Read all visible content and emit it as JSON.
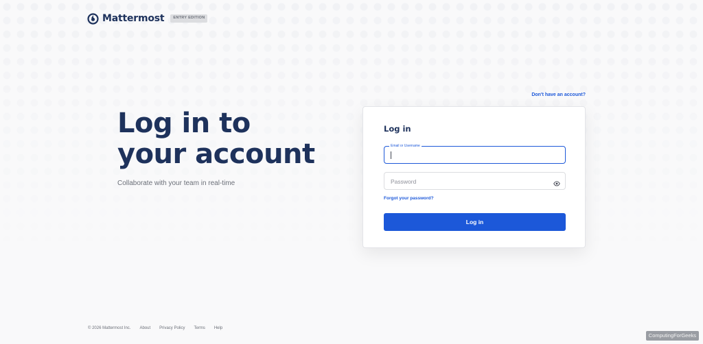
{
  "brand": {
    "name": "Mattermost",
    "edition": "ENTRY EDITION",
    "logo_icon": "mattermost-logo-icon",
    "color": "#1e325c"
  },
  "signup": {
    "link": "Don't have an account?"
  },
  "hero": {
    "title_line1": "Log in to",
    "title_line2": "your account",
    "subtitle": "Collaborate with your team in real-time"
  },
  "login_card": {
    "title": "Log in",
    "email_label": "Email or Username",
    "email_value": "",
    "password_placeholder": "Password",
    "password_toggle_icon": "eye-icon",
    "forgot_link": "Forgot your password?",
    "submit_label": "Log in"
  },
  "footer": {
    "copyright": "© 2026 Mattermost Inc.",
    "links": [
      "About",
      "Privacy Policy",
      "Terms",
      "Help"
    ]
  },
  "watermark": "ComputingForGeeks",
  "colors": {
    "accent": "#1c58d9",
    "background": "#f9f9fa"
  }
}
